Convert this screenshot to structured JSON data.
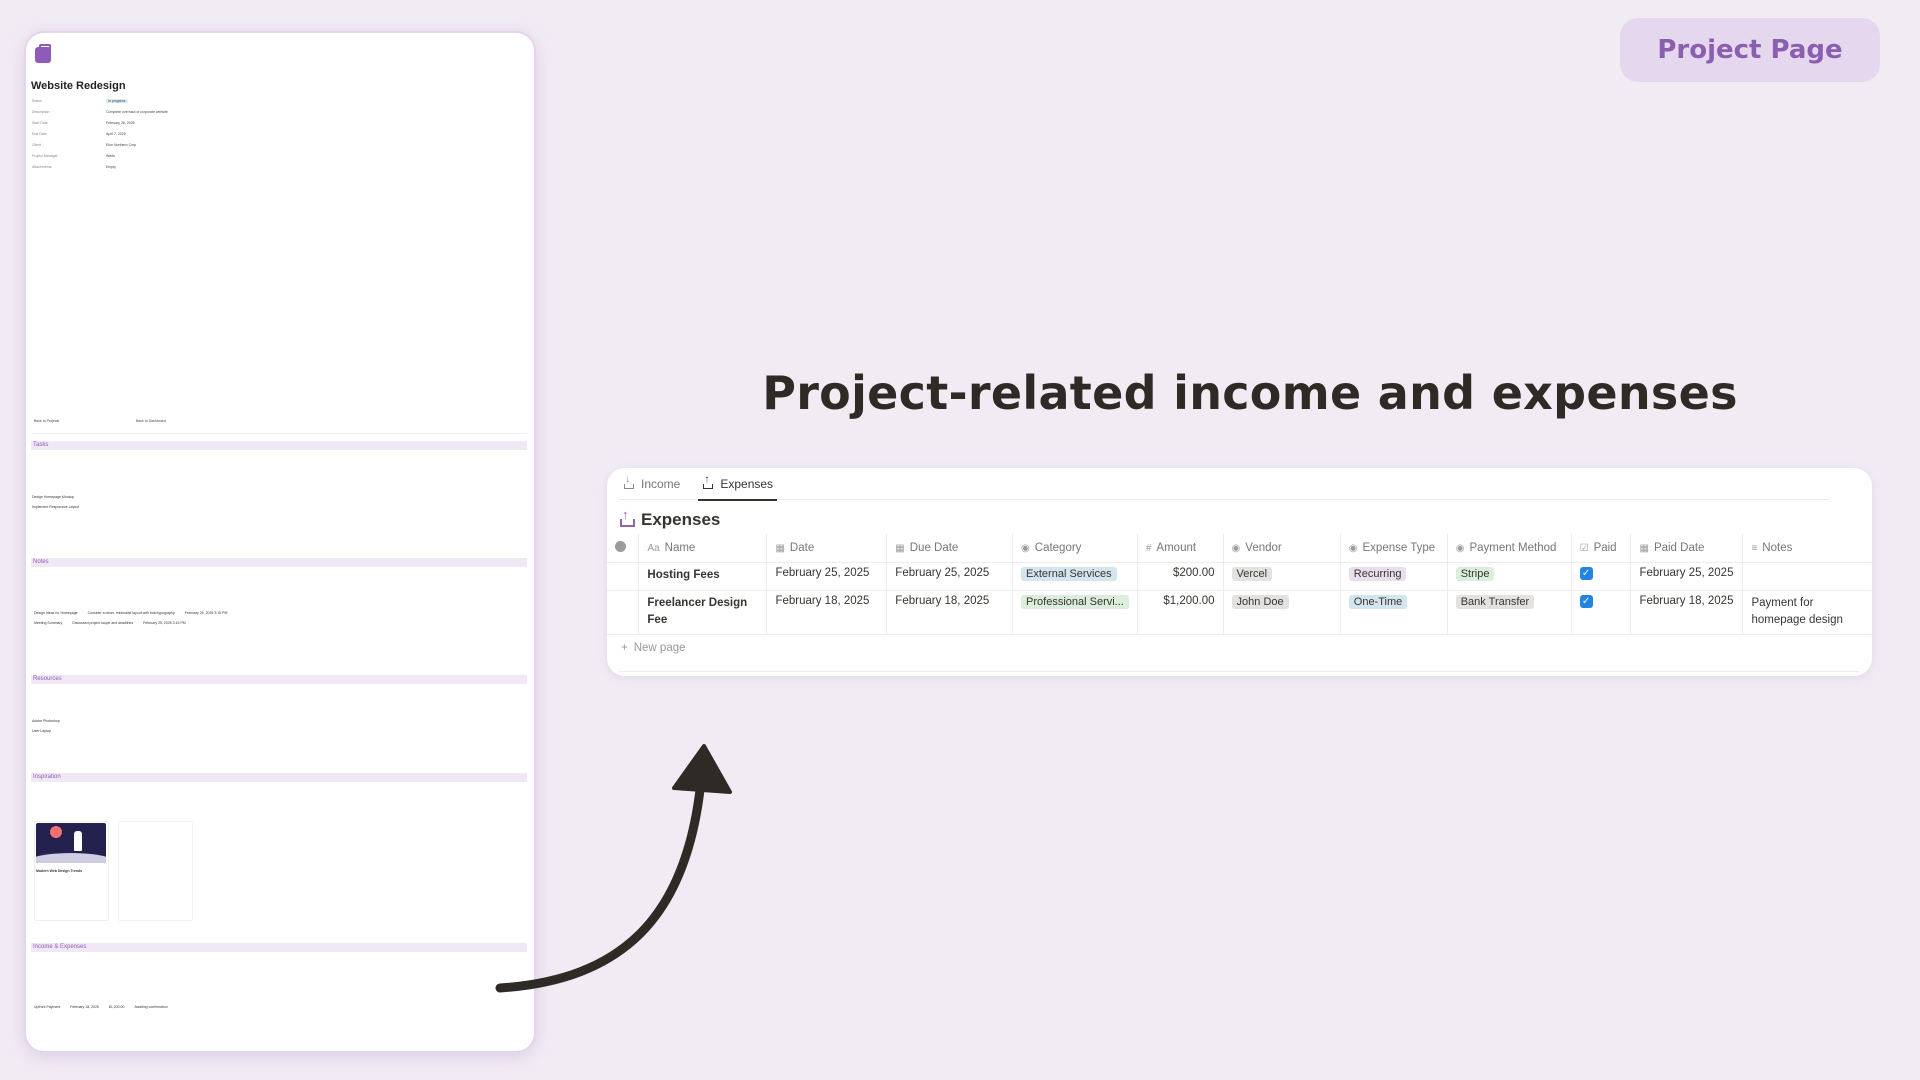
{
  "badge": "Project Page",
  "headline": "Project-related income and expenses",
  "mini": {
    "title": "Website Redesign",
    "sections": [
      "Tasks",
      "Notes",
      "Resources",
      "Inspiration",
      "Income & Expenses"
    ],
    "nav_buttons": [
      "Back to Projects",
      "Back to Dashboard"
    ],
    "properties": [
      {
        "label": "Status",
        "value": "In progress"
      },
      {
        "label": "Description",
        "value": "Complete overhaul of corporate website"
      },
      {
        "label": "Start Date",
        "value": "February 28, 2025"
      },
      {
        "label": "End Date",
        "value": "April 7, 2025"
      },
      {
        "label": "Client",
        "value": "Elon Northern Corp"
      },
      {
        "label": "Project Manager",
        "value": "Weds"
      },
      {
        "label": "Attachments",
        "value": "Empty"
      }
    ],
    "task_rows": [
      "Design Homepage Mockup",
      "Implement Responsive Layout"
    ],
    "note_rows": [
      {
        "title": "Design Ideas for Homepage",
        "content": "Consider a clean, minimalist layout with bold typography",
        "created": "February 25, 2025 3:15 PM"
      },
      {
        "title": "Meeting Summary",
        "content": "Discussed project scope and deadlines",
        "created": "February 25, 2025 3:15 PM"
      }
    ],
    "resource_rows": [
      "Adobe Photoshop",
      "User Laptop"
    ],
    "inspiration_card": "Modern Web Design Trends",
    "income_row": {
      "name": "Upfront Payment",
      "date": "February 18, 2025",
      "amount": "$1,200.00",
      "notes": "Awaiting confirmation"
    }
  },
  "panel": {
    "tabs": [
      {
        "label": "Income",
        "icon": "income-icon"
      },
      {
        "label": "Expenses",
        "icon": "expenses-icon"
      }
    ],
    "active_tab": "Expenses",
    "db_title": "Expenses",
    "columns": [
      {
        "label": "Name",
        "icon": "Aa"
      },
      {
        "label": "Date",
        "icon": "calendar"
      },
      {
        "label": "Due Date",
        "icon": "calendar"
      },
      {
        "label": "Category",
        "icon": "select"
      },
      {
        "label": "Amount",
        "icon": "#"
      },
      {
        "label": "Vendor",
        "icon": "select"
      },
      {
        "label": "Expense Type",
        "icon": "select"
      },
      {
        "label": "Payment Method",
        "icon": "select"
      },
      {
        "label": "Paid",
        "icon": "checkbox"
      },
      {
        "label": "Paid Date",
        "icon": "calendar"
      },
      {
        "label": "Notes",
        "icon": "text"
      }
    ],
    "rows": [
      {
        "name": "Hosting Fees",
        "date": "February 25, 2025",
        "due_date": "February 25, 2025",
        "category": "External Services",
        "amount": "$200.00",
        "vendor": "Vercel",
        "expense_type": "Recurring",
        "payment_method": "Stripe",
        "paid": true,
        "paid_date": "February 25, 2025",
        "notes": ""
      },
      {
        "name": "Freelancer Design Fee",
        "date": "February 18, 2025",
        "due_date": "February 18, 2025",
        "category": "Professional Servi...",
        "amount": "$1,200.00",
        "vendor": "John Doe",
        "expense_type": "One-Time",
        "payment_method": "Bank Transfer",
        "paid": true,
        "paid_date": "February 18, 2025",
        "notes": "Payment for homepage design"
      }
    ],
    "new_page": "New page",
    "colors": {
      "blue_pill": "#d3e5ef",
      "green_pill": "#dbeddb",
      "gray_pill": "#e3e2e0",
      "purple_pill": "#e8deee",
      "checkbox": "#2383e2",
      "accent_purple": "#8b5fb0",
      "background": "#f1ecf4"
    }
  }
}
